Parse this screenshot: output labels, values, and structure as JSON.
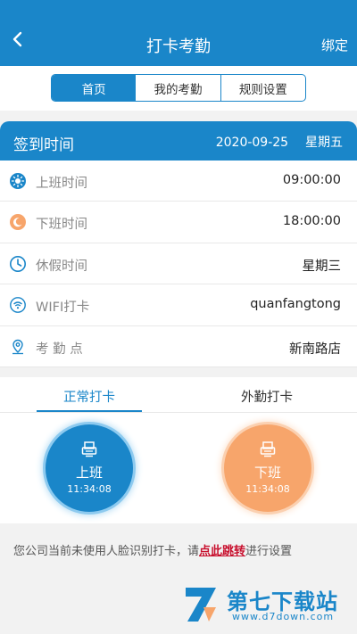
{
  "header": {
    "title": "打卡考勤",
    "action_label": "绑定",
    "back_icon": "chevron-left-icon"
  },
  "segments": [
    {
      "label": "首页",
      "active": true
    },
    {
      "label": "我的考勤",
      "active": false
    },
    {
      "label": "规则设置",
      "active": false
    }
  ],
  "signin": {
    "label": "签到时间",
    "date": "2020-09-25",
    "weekday": "星期五"
  },
  "rows": [
    {
      "label": "上班时间",
      "value": "09:00:00",
      "icon": "sun-icon"
    },
    {
      "label": "下班时间",
      "value": "18:00:00",
      "icon": "moon-icon"
    },
    {
      "label": "休假时间",
      "value": "星期三",
      "icon": "clock-icon"
    },
    {
      "label": "WIFI打卡",
      "value": "quanfangtong",
      "icon": "wifi-icon"
    },
    {
      "label": "考 勤 点",
      "value": "新南路店",
      "icon": "location-icon"
    }
  ],
  "tabs": [
    {
      "label": "正常打卡",
      "active": true
    },
    {
      "label": "外勤打卡",
      "active": false
    }
  ],
  "punch": {
    "on": {
      "label": "上班",
      "time": "11:34:08",
      "color": "#1a86c9"
    },
    "off": {
      "label": "下班",
      "time": "11:34:08",
      "color": "#f7a56b"
    }
  },
  "notice": {
    "before": "您公司当前未使用人脸识别打卡，请",
    "link": "点此跳转",
    "after": "进行设置"
  },
  "watermark": {
    "name": "第七下载站",
    "url": "www.d7down.com"
  },
  "colors": {
    "primary": "#1a86c9",
    "accent_orange": "#f7a56b",
    "link_red": "#c8102e"
  }
}
